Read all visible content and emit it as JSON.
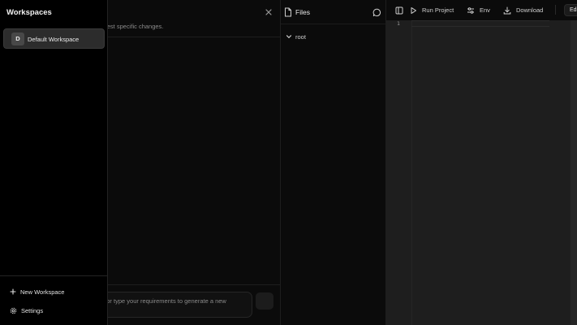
{
  "workspaces_drawer": {
    "title": "Workspaces",
    "items": [
      {
        "initial": "D",
        "name": "Default Workspace"
      }
    ],
    "new_workspace_label": "New Workspace",
    "settings_label": "Settings"
  },
  "chat": {
    "subtitle_fragment": "or request specific changes.",
    "input_placeholder_fragment": "e or type your requirements to generate a new"
  },
  "files": {
    "title": "Files",
    "tree": [
      {
        "name": "root",
        "expanded": true
      }
    ]
  },
  "toolbar": {
    "run_label": "Run Project",
    "env_label": "Env",
    "download_label": "Download",
    "edit_label": "Edi"
  },
  "editor": {
    "line_numbers": [
      "1"
    ]
  },
  "icons": {
    "panel_toggle": "panel-toggle-icon",
    "run": "play-icon",
    "env": "sliders-icon",
    "download": "download-icon",
    "files": "file-icon",
    "chat": "message-circle-icon",
    "close": "close-icon",
    "new": "plus-icon",
    "settings": "gear-icon",
    "tree_toggle": "chevron-down-icon"
  },
  "colors": {
    "background": "#0a0a0a",
    "drawer": "#000000",
    "editor": "#1e1e1e",
    "active_card": "#2c2c2c"
  }
}
